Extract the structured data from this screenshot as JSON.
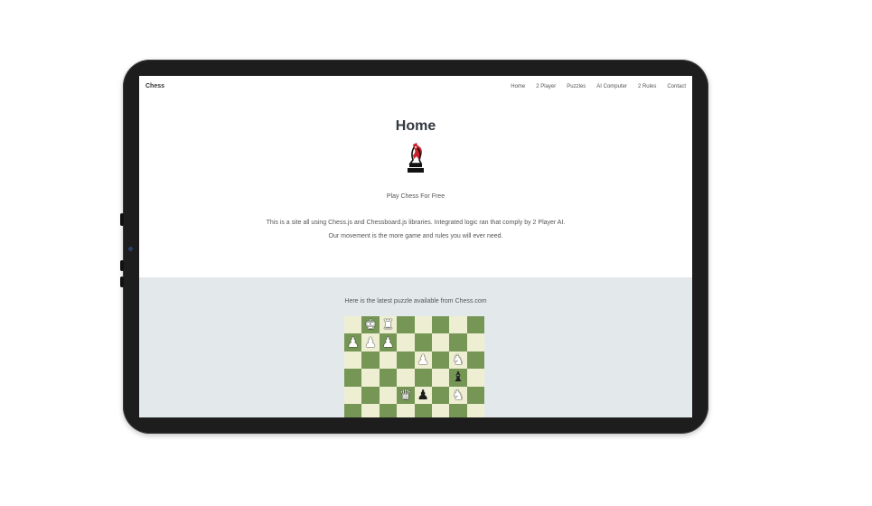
{
  "navbar": {
    "brand": "Chess",
    "links": [
      "Home",
      "2 Player",
      "Puzzles",
      "AI Computer",
      "2 Rules",
      "Contact"
    ]
  },
  "hero": {
    "title": "Home",
    "subtitle": "Play Chess For Free",
    "description": "This is a site all using Chess.js and Chessboard.js libraries. Integrated logic ran that comply by 2 Player AI. Our movement is the more game and rules you will ever need."
  },
  "puzzle": {
    "caption": "Here is the latest puzzle available from Chess.com",
    "board": [
      [
        "",
        "wK",
        "wR",
        "",
        "",
        "",
        "",
        ""
      ],
      [
        "wP",
        "wP",
        "wP",
        "",
        "",
        "",
        "",
        ""
      ],
      [
        "",
        "",
        "",
        "",
        "wP",
        "",
        "wN",
        ""
      ],
      [
        "",
        "",
        "",
        "",
        "",
        "",
        "bB",
        ""
      ],
      [
        "",
        "",
        "",
        "wQ",
        "bP",
        "",
        "wN",
        ""
      ],
      [
        "",
        "",
        "",
        "",
        "",
        "",
        "",
        ""
      ],
      [
        "",
        "",
        "",
        "",
        "",
        "",
        "",
        ""
      ],
      [
        "",
        "",
        "",
        "",
        "",
        "",
        "",
        ""
      ]
    ]
  },
  "colors": {
    "light_square": "#eeeed2",
    "dark_square": "#769656",
    "puzzle_bg": "#e3e9ea",
    "logo_accent": "#c8232c"
  },
  "icons": {
    "logo": "chess-knight-logo-icon"
  }
}
